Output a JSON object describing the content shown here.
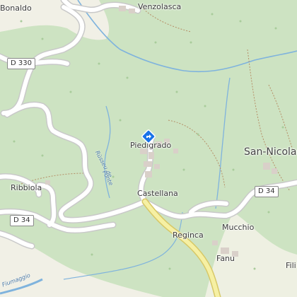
{
  "map": {
    "colors": {
      "forest": "#cde3c2",
      "meadow": "#f1f0e6",
      "road_fill": "#ffffff",
      "road_casing": "#c9c9c9",
      "primary_road": "#f6f0a3",
      "primary_casing": "#d7c867",
      "river": "#7fb3dd",
      "building": "#d9d0c9",
      "path": "#b58e66",
      "marker": "#1a73e8"
    },
    "labels": {
      "bonaldo": "Bonaldo",
      "venzolasca": "Venzolasca",
      "piedigrado": "Piedigrado",
      "castellana": "Castellana",
      "ribbiola": "Ribbiola",
      "reginca": "Reginca",
      "mucchio": "Mucchio",
      "fanu": "Fanu",
      "san_nicolao": "San-Nicolao",
      "fili": "Fili",
      "stream_upper": "Rùsseu de",
      "stream_lower": "Ponte",
      "stream_bottom": "Fiumaggio"
    },
    "road_shields": {
      "d330": "D 330",
      "d34_west": "D 34",
      "d34_east": "D 34"
    },
    "marker": {
      "icon": "directions-diamond-icon"
    }
  }
}
